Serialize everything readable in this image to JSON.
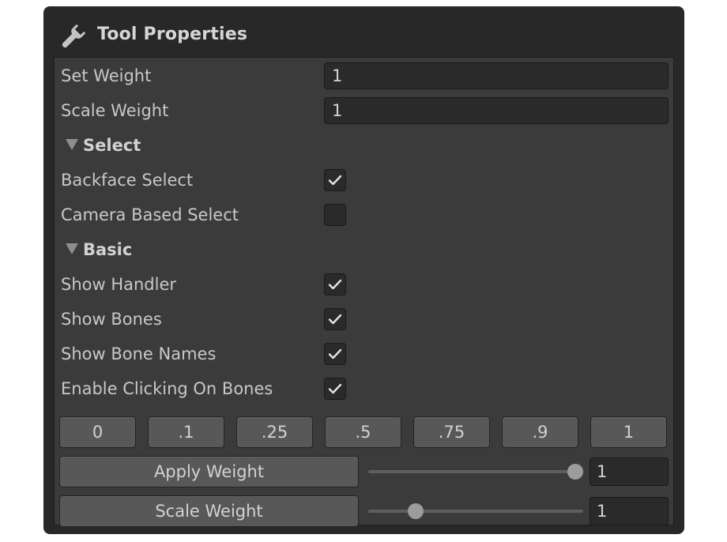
{
  "panel": {
    "title": "Tool Properties",
    "icon": "wrench-icon"
  },
  "fields": {
    "set_weight_label": "Set Weight",
    "set_weight_value": "1",
    "scale_weight_label": "Scale Weight",
    "scale_weight_value": "1"
  },
  "select_section": {
    "title": "Select",
    "expanded": true,
    "backface_select_label": "Backface Select",
    "backface_select_checked": true,
    "camera_based_select_label": "Camera Based Select",
    "camera_based_select_checked": false
  },
  "basic_section": {
    "title": "Basic",
    "expanded": true,
    "show_handler_label": "Show Handler",
    "show_handler_checked": true,
    "show_bones_label": "Show Bones",
    "show_bones_checked": true,
    "show_bone_names_label": "Show Bone Names",
    "show_bone_names_checked": true,
    "enable_clicking_label": "Enable Clicking On Bones",
    "enable_clicking_checked": true
  },
  "presets": [
    {
      "label": "0"
    },
    {
      "label": ".1"
    },
    {
      "label": ".25"
    },
    {
      "label": ".5"
    },
    {
      "label": ".75"
    },
    {
      "label": ".9"
    },
    {
      "label": "1"
    }
  ],
  "apply_weight": {
    "button_label": "Apply Weight",
    "slider_value": 1,
    "slider_min": 0,
    "slider_max": 1,
    "field_value": "1"
  },
  "scale_weight_row": {
    "button_label": "Scale Weight",
    "slider_value": 1,
    "slider_min": 0,
    "slider_max": 5,
    "field_value": "1"
  }
}
